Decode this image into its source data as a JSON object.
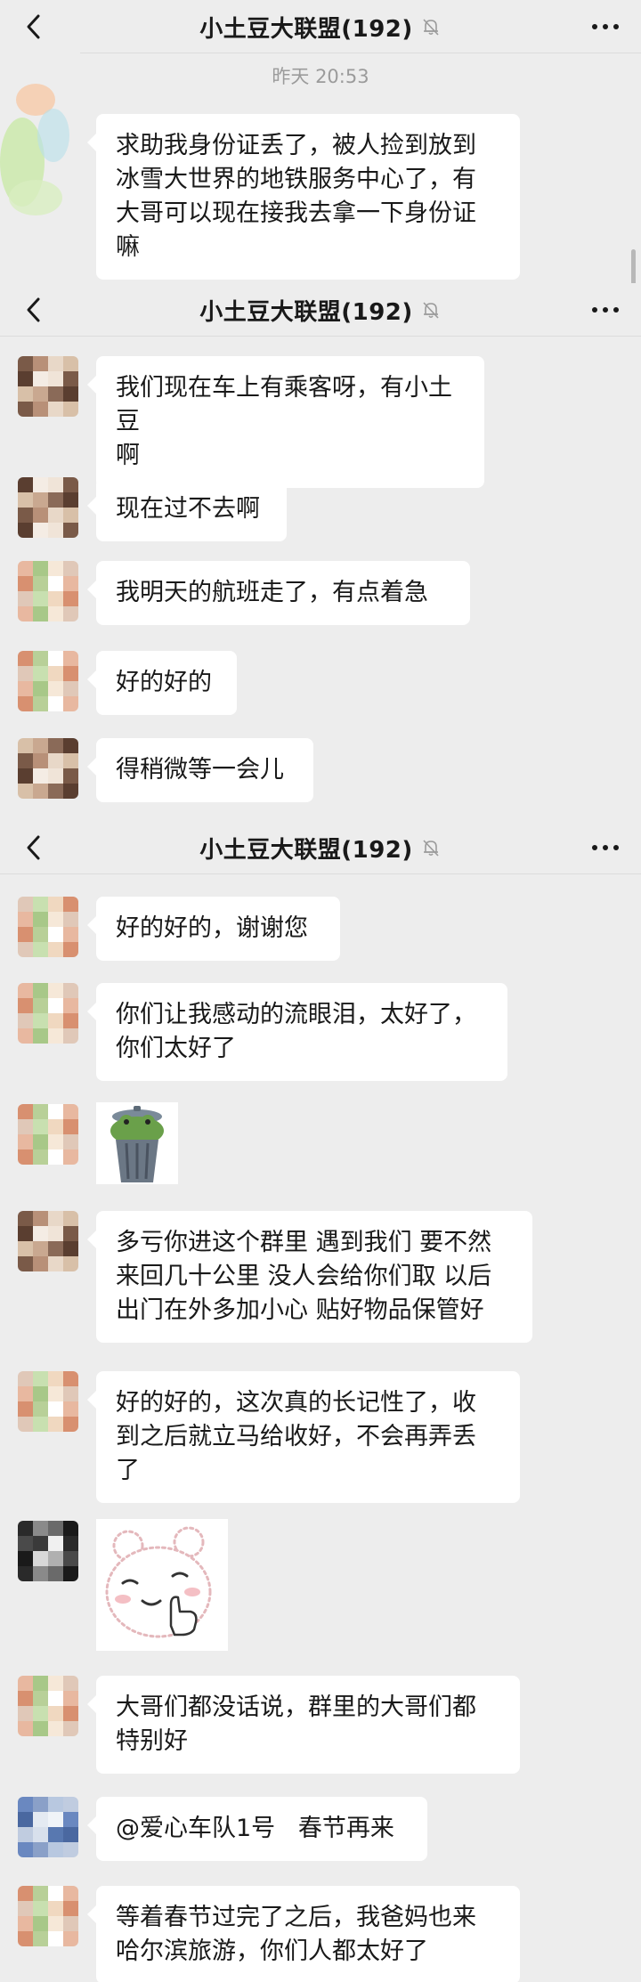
{
  "chat": {
    "title": "小土豆大联盟(192)",
    "timestamp": "昨天 20:53"
  },
  "messages": [
    {
      "sender": "user-a",
      "text": "求助我身份证丢了，被人捡到放到\n冰雪大世界的地铁服务中心了，有\n大哥可以现在接我去拿一下身份证\n嘛"
    },
    {
      "sender": "user-b",
      "text": "我们现在车上有乘客呀，有小土豆\n啊"
    },
    {
      "sender": "user-b",
      "text": "现在过不去啊"
    },
    {
      "sender": "user-c",
      "text": "我明天的航班走了，有点着急"
    },
    {
      "sender": "user-c",
      "text": "好的好的"
    },
    {
      "sender": "user-b",
      "text": "得稍微等一会儿"
    },
    {
      "sender": "user-c",
      "text": "好的好的，谢谢您"
    },
    {
      "sender": "user-c",
      "text": "你们让我感动的流眼泪，太好了，\n你们太好了"
    },
    {
      "sender": "user-c",
      "sticker": "frog-in-trash-can"
    },
    {
      "sender": "user-b",
      "text": "多亏你进这个群里 遇到我们 要不然\n来回几十公里 没人会给你们取 以后\n出门在外多加小心 贴好物品保管好"
    },
    {
      "sender": "user-c",
      "text": "好的好的，这次真的长记性了，收\n到之后就立马给收好，不会再弄丢\n了"
    },
    {
      "sender": "user-d",
      "sticker": "bear-thumbs-up"
    },
    {
      "sender": "user-c",
      "text": "大哥们都没话说，群里的大哥们都\n特别好"
    },
    {
      "sender": "user-e",
      "text": "@爱心车队1号   春节再来"
    },
    {
      "sender": "user-c",
      "text": "等着春节过完了之后，我爸妈也来\n哈尔滨旅游，你们人都太好了"
    }
  ],
  "icons": {
    "back": "chevron-left-icon",
    "mute": "bell-muted-icon",
    "more": "more-dots-icon"
  },
  "colors": {
    "background": "#ededed",
    "bubble": "#ffffff",
    "text": "#191919",
    "timestamp": "#9b9b9b"
  }
}
